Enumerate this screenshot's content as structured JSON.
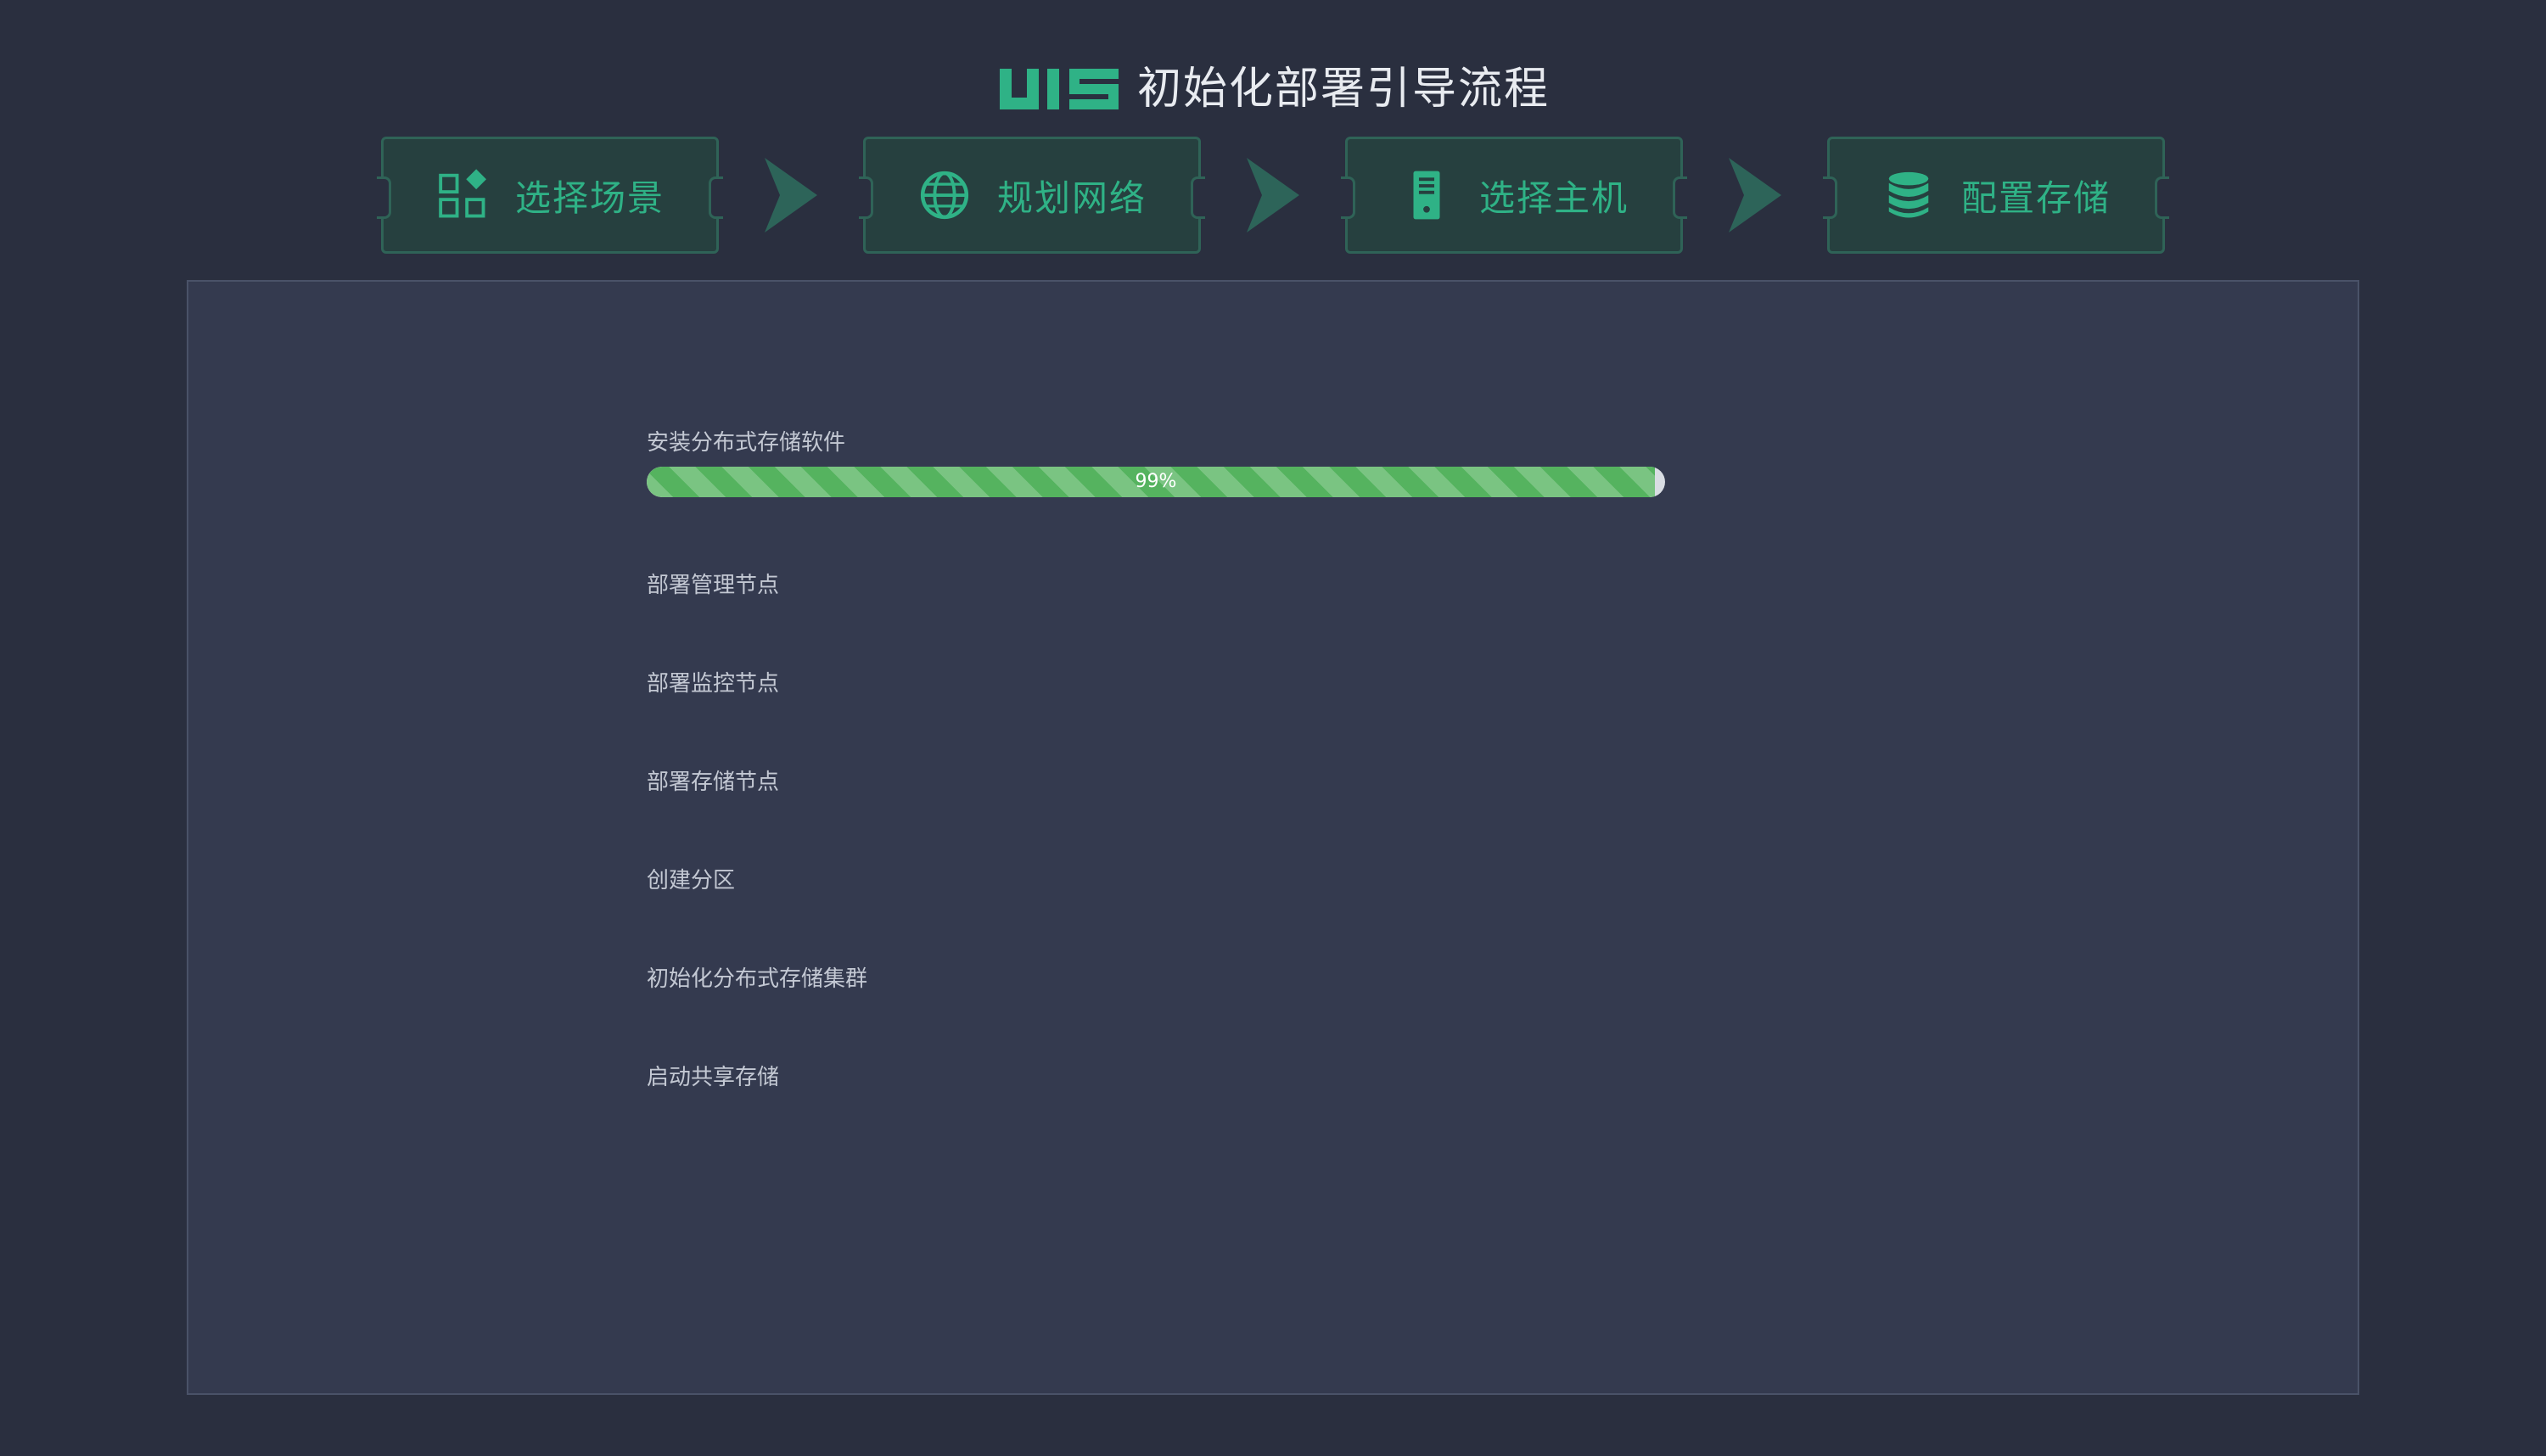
{
  "header": {
    "logo_text": "UIS",
    "title": "初始化部署引导流程"
  },
  "colors": {
    "accent": "#2fb286",
    "progress_fill": "#55b35f",
    "background": "#2a2f3f",
    "panel": "#343a4f"
  },
  "steps": [
    {
      "label": "选择场景",
      "icon": "apps-icon"
    },
    {
      "label": "规划网络",
      "icon": "globe-icon"
    },
    {
      "label": "选择主机",
      "icon": "server-icon"
    },
    {
      "label": "配置存储",
      "icon": "database-icon"
    }
  ],
  "tasks": [
    {
      "label": "安装分布式存储软件",
      "progress": 0.99,
      "progress_text": "99%"
    },
    {
      "label": "部署管理节点"
    },
    {
      "label": "部署监控节点"
    },
    {
      "label": "部署存储节点"
    },
    {
      "label": "创建分区"
    },
    {
      "label": "初始化分布式存储集群"
    },
    {
      "label": "启动共享存储"
    }
  ]
}
